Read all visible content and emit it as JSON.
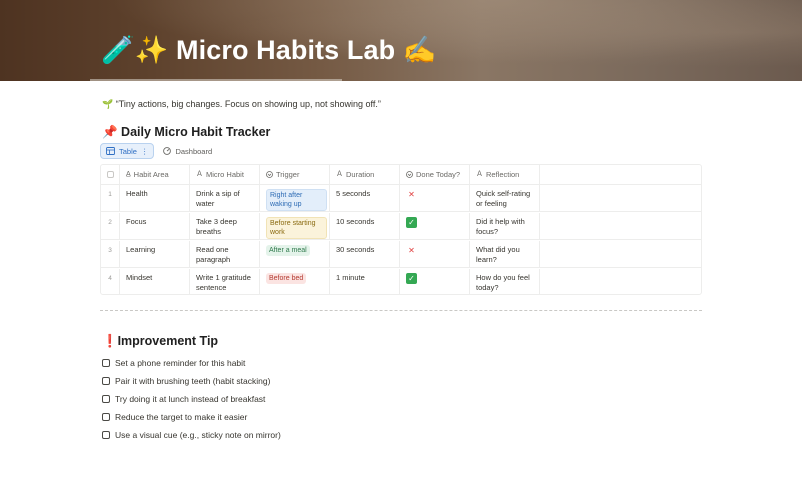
{
  "page": {
    "title": "🧪✨ Micro Habits Lab ✍️",
    "quote": "🌱 “Tiny actions, big changes. Focus on showing up, not showing off.”"
  },
  "database": {
    "title": "📌 Daily Micro Habit Tracker",
    "views": [
      {
        "label": "Table",
        "icon": "table-icon",
        "active": true
      },
      {
        "label": "Dashboard",
        "icon": "dashboard-icon",
        "active": false
      }
    ],
    "columns": [
      {
        "label": "Habit Area",
        "icon": "text-icon"
      },
      {
        "label": "Micro Habit",
        "icon": "text-icon"
      },
      {
        "label": "Trigger",
        "icon": "select-icon"
      },
      {
        "label": "Duration",
        "icon": "text-icon"
      },
      {
        "label": "Done Today?",
        "icon": "select-icon"
      },
      {
        "label": "Reflection",
        "icon": "text-icon"
      }
    ],
    "rows": [
      {
        "num": "1",
        "area": "Health",
        "habit": "Drink a sip of water",
        "trigger": "Right after waking up",
        "trigger_color": "blue",
        "duration": "5 seconds",
        "done": "❌",
        "done_state": "no",
        "reflection": "Quick self-rating or feeling"
      },
      {
        "num": "2",
        "area": "Focus",
        "habit": "Take 3 deep breaths",
        "trigger": "Before starting work",
        "trigger_color": "yellow",
        "duration": "10 seconds",
        "done": "✅",
        "done_state": "yes",
        "reflection": "Did it help with focus?"
      },
      {
        "num": "3",
        "area": "Learning",
        "habit": "Read one paragraph",
        "trigger": "After a meal",
        "trigger_color": "green",
        "duration": "30 seconds",
        "done": "❌",
        "done_state": "no",
        "reflection": "What did you learn?"
      },
      {
        "num": "4",
        "area": "Mindset",
        "habit": "Write 1 gratitude sentence",
        "trigger": "Before bed",
        "trigger_color": "red",
        "duration": "1 minute",
        "done": "✅",
        "done_state": "yes",
        "reflection": "How do you feel today?"
      }
    ]
  },
  "tips": {
    "title_mark": "❗",
    "title": "Improvement Tip",
    "items": [
      {
        "label": "Set a phone reminder for this habit",
        "checked": false
      },
      {
        "label": "Pair it with brushing teeth (habit stacking)",
        "checked": false
      },
      {
        "label": "Try doing it at lunch instead of breakfast",
        "checked": false
      },
      {
        "label": "Reduce the target to make it easier",
        "checked": false
      },
      {
        "label": "Use a visual cue (e.g., sticky note on mirror)",
        "checked": false
      }
    ]
  }
}
